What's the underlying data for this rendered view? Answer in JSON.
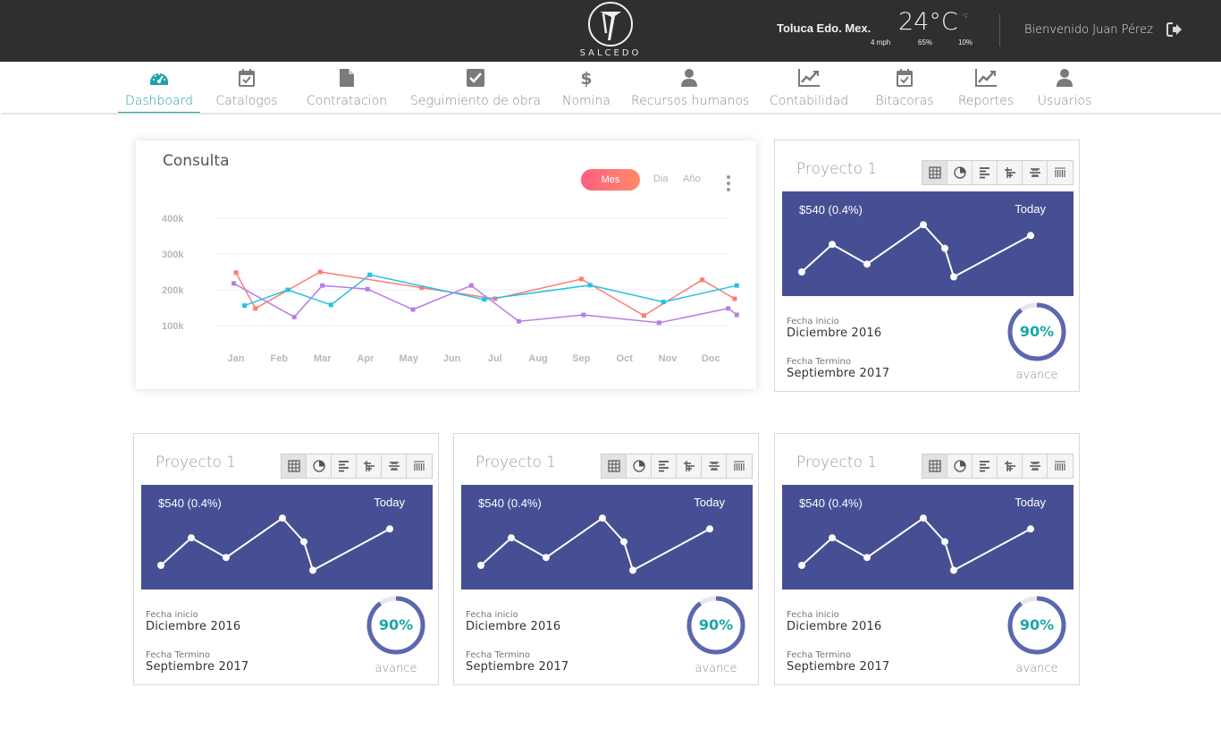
{
  "header": {
    "logo_text": "SALCEDO",
    "location": "Toluca Edo. Mex.",
    "temperature": "24°C",
    "temp_unit": "°F",
    "wind": "4 mph",
    "humidity": "65%",
    "precip": "10%",
    "welcome": "Bienvenido Juan Pérez",
    "logout_icon": "logout-icon"
  },
  "nav": {
    "items": [
      {
        "label": "Dashboard",
        "icon": "dashboard-gauge-icon",
        "active": true
      },
      {
        "label": "Catalogos",
        "icon": "calendar-check-icon"
      },
      {
        "label": "Contratacion",
        "icon": "document-icon"
      },
      {
        "label": "Seguimiento de obra",
        "icon": "checkbox-icon"
      },
      {
        "label": "Nomina",
        "icon": "dollar-icon"
      },
      {
        "label": "Recursos humanos",
        "icon": "user-icon"
      },
      {
        "label": "Contabilidad",
        "icon": "line-chart-icon"
      },
      {
        "label": "Bitacoras",
        "icon": "calendar-check-icon"
      },
      {
        "label": "Reportes",
        "icon": "line-chart-icon"
      },
      {
        "label": "Usuarios",
        "icon": "user-icon"
      }
    ]
  },
  "consulta": {
    "title": "Consulta",
    "options": {
      "mes": "Mes",
      "dia": "Dia",
      "ano": "Año"
    }
  },
  "chart_data": {
    "type": "line",
    "title": "Consulta",
    "categories": [
      "Jan",
      "Feb",
      "Mar",
      "Apr",
      "May",
      "Jun",
      "Jul",
      "Aug",
      "Sep",
      "Oct",
      "Nov",
      "Doc"
    ],
    "y_ticks": [
      "400k",
      "300k",
      "200k",
      "100k"
    ],
    "ylim": [
      100000,
      400000
    ],
    "grid": true,
    "series": [
      {
        "color": "#ff7b72",
        "x": [
          0.0,
          0.45,
          1.95,
          4.3,
          6.0,
          8.0,
          9.45,
          10.8,
          11.55
        ],
        "values": [
          248000,
          148000,
          250000,
          206000,
          175000,
          230000,
          128000,
          228000,
          175000
        ]
      },
      {
        "color": "#22c3e6",
        "x": [
          0.2,
          1.2,
          2.2,
          3.1,
          5.75,
          8.2,
          9.9,
          11.6
        ],
        "values": [
          156000,
          200000,
          158000,
          242000,
          173000,
          213000,
          166000,
          212000
        ]
      },
      {
        "color": "#b57ee6",
        "x": [
          -0.05,
          1.35,
          2.0,
          3.05,
          4.1,
          5.45,
          6.55,
          8.05,
          9.8,
          11.4,
          11.6
        ],
        "values": [
          218000,
          124000,
          212000,
          202000,
          145000,
          212000,
          112000,
          130000,
          108000,
          148000,
          130000
        ]
      }
    ]
  },
  "projects": [
    {
      "title": "Proyecto 1",
      "amount": "$540  (0.4%)",
      "today": "Today",
      "start_label": "Fecha inicio",
      "start": "Diciembre 2016",
      "end_label": "Fecha Termino",
      "end": "Septiembre 2017",
      "progress_text": "90%",
      "progress": 0.9,
      "avance": "avance",
      "trend": [
        0.2,
        0.48,
        0.28,
        0.68,
        0.44,
        0.15,
        0.57
      ]
    },
    {
      "title": "Proyecto 1",
      "amount": "$540  (0.4%)",
      "today": "Today",
      "start_label": "Fecha inicio",
      "start": "Diciembre 2016",
      "end_label": "Fecha Termino",
      "end": "Septiembre 2017",
      "progress_text": "90%",
      "progress": 0.9,
      "avance": "avance",
      "trend": [
        0.2,
        0.48,
        0.28,
        0.68,
        0.44,
        0.15,
        0.57
      ]
    },
    {
      "title": "Proyecto 1",
      "amount": "$540  (0.4%)",
      "today": "Today",
      "start_label": "Fecha inicio",
      "start": "Diciembre 2016",
      "end_label": "Fecha Termino",
      "end": "Septiembre 2017",
      "progress_text": "90%",
      "progress": 0.9,
      "avance": "avance",
      "trend": [
        0.2,
        0.48,
        0.28,
        0.68,
        0.44,
        0.15,
        0.57
      ]
    },
    {
      "title": "Proyecto 1",
      "amount": "$540  (0.4%)",
      "today": "Today",
      "start_label": "Fecha inicio",
      "start": "Diciembre 2016",
      "end_label": "Fecha Termino",
      "end": "Septiembre 2017",
      "progress_text": "90%",
      "progress": 0.9,
      "avance": "avance",
      "trend": [
        0.2,
        0.48,
        0.28,
        0.68,
        0.44,
        0.15,
        0.57
      ]
    }
  ],
  "toolbar_icons": [
    "table-icon",
    "pie-chart-icon",
    "align-left-icon",
    "indent-icon",
    "strikethrough-icon",
    "columns-icon"
  ]
}
